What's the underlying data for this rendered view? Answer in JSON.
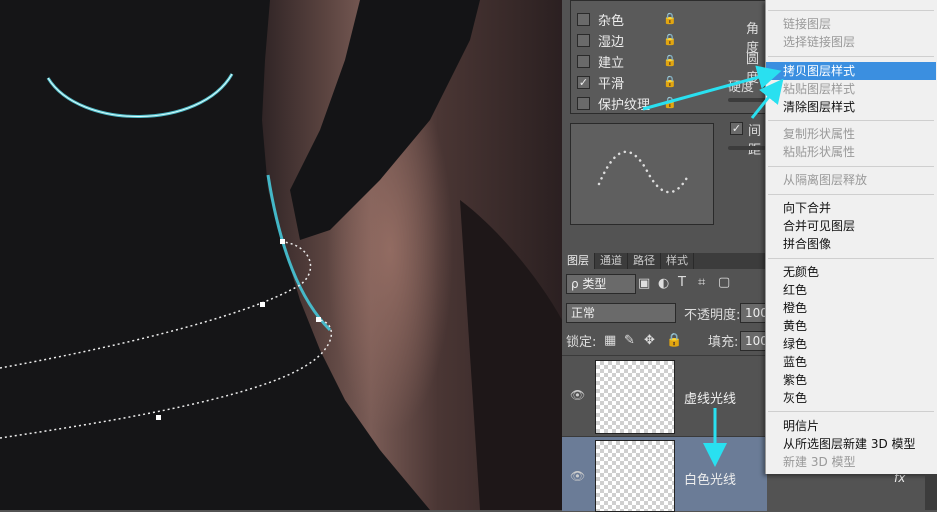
{
  "style_list": {
    "items": [
      {
        "label": "杂色",
        "checked": false
      },
      {
        "label": "湿边",
        "checked": false
      },
      {
        "label": "建立",
        "checked": false
      },
      {
        "label": "平滑",
        "checked": true
      },
      {
        "label": "保护纹理",
        "checked": false
      }
    ]
  },
  "brush_settings": {
    "angle_label": "角度",
    "roundness_label": "圆度",
    "hardness_label": "硬度",
    "spacing_label": "间距"
  },
  "layers_panel": {
    "tabs": [
      {
        "label": "图层",
        "active": true
      },
      {
        "label": "通道",
        "active": false
      },
      {
        "label": "路径",
        "active": false
      },
      {
        "label": "样式",
        "active": false
      }
    ],
    "filter_label": "ρ 类型",
    "blend_mode": "正常",
    "opacity_label": "不透明度:",
    "opacity_value": "100",
    "lock_label": "锁定:",
    "fill_label": "填充:",
    "fill_value": "100",
    "layers": [
      {
        "name": "虚线光线",
        "selected": false,
        "fx": ""
      },
      {
        "name": "白色光线",
        "selected": true,
        "fx": "fx"
      }
    ]
  },
  "context_menu": {
    "items": [
      {
        "label": "链接图层",
        "disabled": true,
        "highlighted": false
      },
      {
        "label": "选择链接图层",
        "disabled": true,
        "highlighted": false
      },
      {
        "label": "拷贝图层样式",
        "disabled": false,
        "highlighted": true
      },
      {
        "label": "粘贴图层样式",
        "disabled": true,
        "highlighted": false
      },
      {
        "label": "清除图层样式",
        "disabled": false,
        "highlighted": false
      },
      {
        "label": "复制形状属性",
        "disabled": true,
        "highlighted": false
      },
      {
        "label": "粘贴形状属性",
        "disabled": true,
        "highlighted": false
      },
      {
        "label": "从隔离图层释放",
        "disabled": true,
        "highlighted": false
      },
      {
        "label": "向下合并",
        "disabled": false,
        "highlighted": false
      },
      {
        "label": "合并可见图层",
        "disabled": false,
        "highlighted": false
      },
      {
        "label": "拼合图像",
        "disabled": false,
        "highlighted": false
      },
      {
        "label": "无颜色",
        "disabled": false,
        "highlighted": false
      },
      {
        "label": "红色",
        "disabled": false,
        "highlighted": false
      },
      {
        "label": "橙色",
        "disabled": false,
        "highlighted": false
      },
      {
        "label": "黄色",
        "disabled": false,
        "highlighted": false
      },
      {
        "label": "绿色",
        "disabled": false,
        "highlighted": false
      },
      {
        "label": "蓝色",
        "disabled": false,
        "highlighted": false
      },
      {
        "label": "紫色",
        "disabled": false,
        "highlighted": false
      },
      {
        "label": "灰色",
        "disabled": false,
        "highlighted": false
      },
      {
        "label": "明信片",
        "disabled": false,
        "highlighted": false
      },
      {
        "label": "从所选图层新建 3D 模型",
        "disabled": false,
        "highlighted": false
      },
      {
        "label": "新建 3D 模型",
        "disabled": true,
        "highlighted": false
      }
    ]
  },
  "colors": {
    "highlight": "#3b8fe0",
    "annotation_arrow": "#29e0f0",
    "selected_layer": "#6b7c97"
  }
}
